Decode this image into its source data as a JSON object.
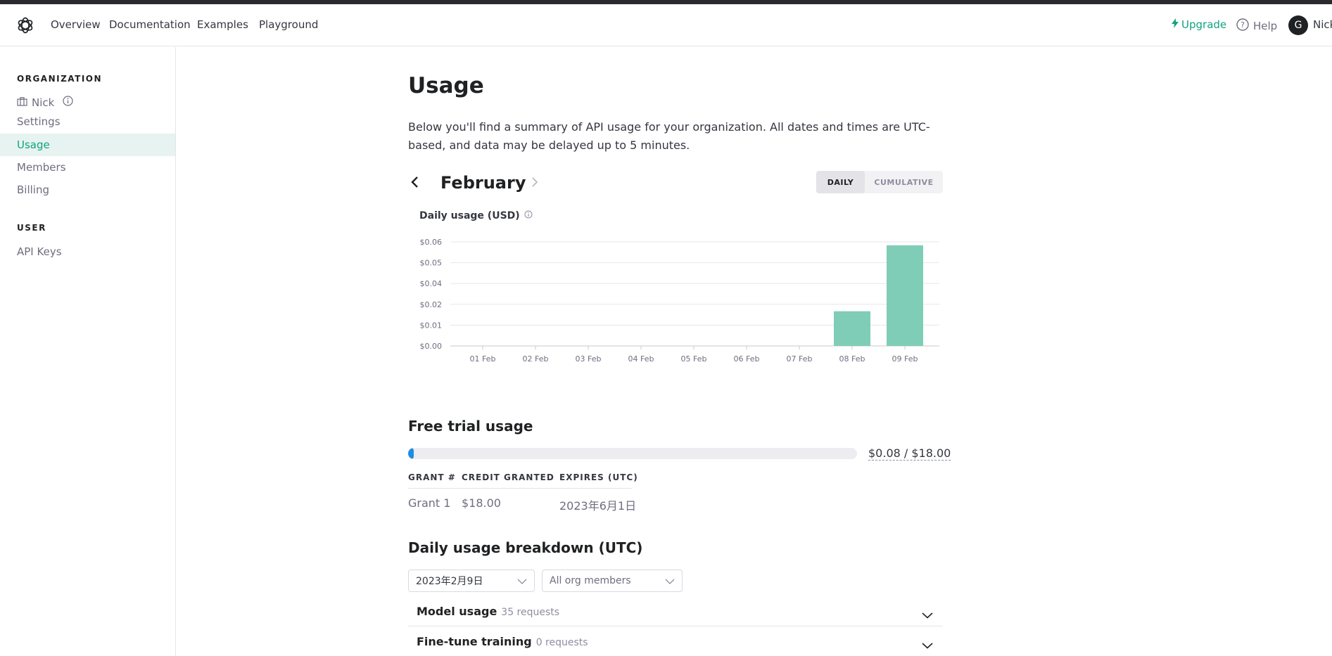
{
  "nav": {
    "links": [
      "Overview",
      "Documentation",
      "Examples",
      "Playground"
    ],
    "upgrade": "Upgrade",
    "help": "Help",
    "avatar_initial": "G",
    "user_name": "Nick"
  },
  "sidebar": {
    "org_heading": "ORGANIZATION",
    "org_name": "Nick",
    "items": [
      {
        "label": "Settings",
        "active": false
      },
      {
        "label": "Usage",
        "active": true
      },
      {
        "label": "Members",
        "active": false
      },
      {
        "label": "Billing",
        "active": false
      }
    ],
    "user_heading": "USER",
    "user_items": [
      {
        "label": "API Keys"
      }
    ]
  },
  "main": {
    "title": "Usage",
    "intro": "Below you'll find a summary of API usage for your organization. All dates and times are UTC-based, and data may be delayed up to 5 minutes.",
    "month": "February",
    "toggle": {
      "daily": "DAILY",
      "cumulative": "CUMULATIVE",
      "selected": "DAILY"
    }
  },
  "chart_data": {
    "type": "bar",
    "title": "Daily usage (USD)",
    "categories": [
      "01 Feb",
      "02 Feb",
      "03 Feb",
      "04 Feb",
      "05 Feb",
      "06 Feb",
      "07 Feb",
      "08 Feb",
      "09 Feb"
    ],
    "values": [
      0,
      0,
      0,
      0,
      0,
      0,
      0,
      0.02,
      0.058
    ],
    "y_ticks": [
      "$0.00",
      "$0.01",
      "$0.02",
      "$0.04",
      "$0.05",
      "$0.06"
    ],
    "ylim": [
      0,
      0.06
    ],
    "grid": true,
    "bar_color": "#7fcdb6"
  },
  "free_trial": {
    "title": "Free trial usage",
    "used": 0.08,
    "total": 18,
    "amount_label": "$0.08 / $18.00",
    "fill_color": "#1f8ce0",
    "columns": [
      "GRANT #",
      "CREDIT GRANTED",
      "EXPIRES (UTC)"
    ],
    "rows": [
      [
        "Grant 1",
        "$18.00",
        "2023年6月1日"
      ]
    ]
  },
  "breakdown": {
    "title": "Daily usage breakdown (UTC)",
    "date_select": "2023年2月9日",
    "member_select": "All org members",
    "sections": [
      {
        "title": "Model usage",
        "count": "35 requests"
      },
      {
        "title": "Fine-tune training",
        "count": "0 requests"
      }
    ]
  },
  "colors": {
    "accent": "#10a37f",
    "active_bg": "#e6f3f0"
  }
}
